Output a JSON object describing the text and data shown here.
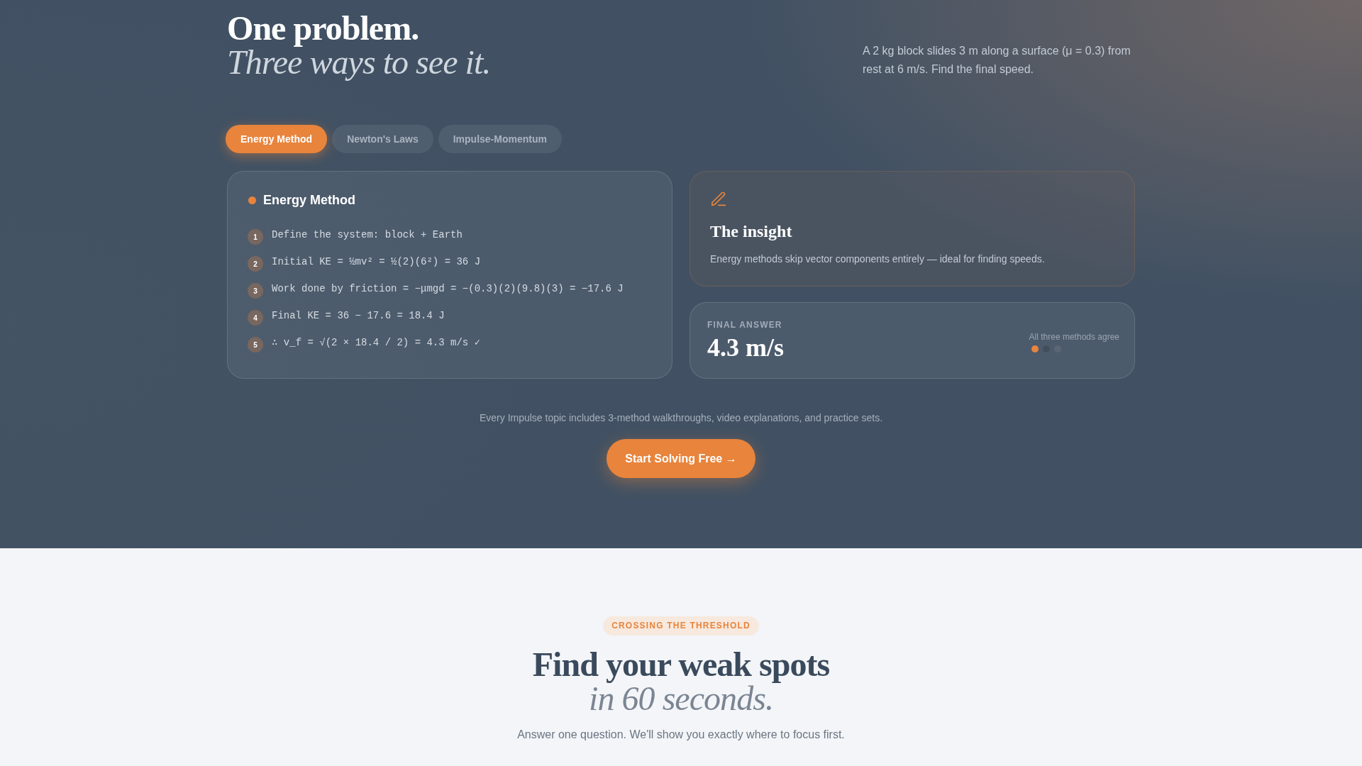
{
  "hero": {
    "title": "One problem.",
    "subtitle": "Three ways to see it.",
    "problem": "A 2 kg block slides 3 m along a surface (μ = 0.3) from rest at 6 m/s. Find the final speed."
  },
  "tabs": [
    {
      "label": "Energy Method",
      "selected": true
    },
    {
      "label": "Newton's Laws",
      "selected": false
    },
    {
      "label": "Impulse-Momentum",
      "selected": false
    }
  ],
  "method_card": {
    "title": "Energy Method",
    "steps": [
      {
        "number": "1",
        "text": "Define the system: block + Earth"
      },
      {
        "number": "2",
        "text": "Initial KE = ½mv² = ½(2)(6²) = 36 J"
      },
      {
        "number": "3",
        "text": "Work done by friction = −μmgd = −(0.3)(2)(9.8)(3) = −17.6 J"
      },
      {
        "number": "4",
        "text": "Final KE = 36 − 17.6 = 18.4 J"
      },
      {
        "number": "5",
        "text": "∴ v_f = √(2 × 18.4 / 2) = 4.3 m/s ✓"
      }
    ]
  },
  "insight_card": {
    "title": "The insight",
    "text": "Energy methods skip vector components entirely — ideal for finding speeds."
  },
  "answer_card": {
    "label": "FINAL ANSWER",
    "value": "4.3 m/s",
    "note": "All three methods agree",
    "dots": [
      {
        "color": "#e8843c"
      },
      {
        "color": "#434e5b"
      },
      {
        "color": "#5b6674"
      }
    ]
  },
  "footnote": "Every Impulse topic includes 3-method walkthroughs, video explanations, and practice sets.",
  "cta": {
    "label": "Start Solving Free →"
  },
  "next_section": {
    "badge": "CROSSING THE THRESHOLD",
    "title": "Find your weak spots",
    "subtitle": "in 60 seconds.",
    "text": "Answer one question. We'll show you exactly where to focus first."
  }
}
